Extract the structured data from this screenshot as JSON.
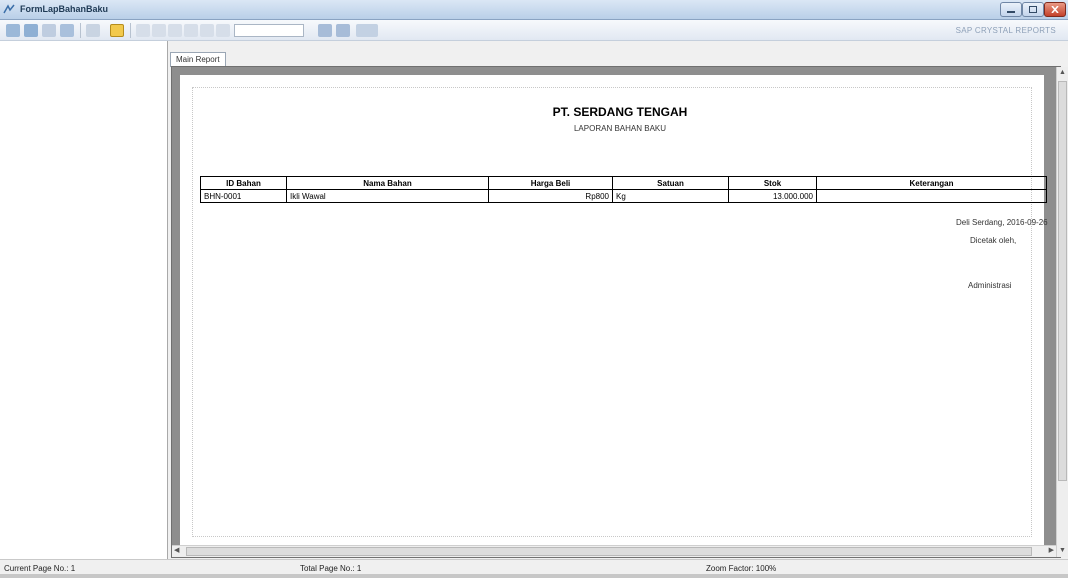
{
  "window": {
    "title": "FormLapBahanBaku"
  },
  "toolbar": {
    "search_value": "",
    "brand_text": "SAP CRYSTAL REPORTS"
  },
  "tabs": [
    {
      "label": "Main Report"
    }
  ],
  "report": {
    "company": "PT. SERDANG TENGAH",
    "title": "LAPORAN BAHAN BAKU",
    "columns": [
      "ID Bahan",
      "Nama Bahan",
      "Harga Beli",
      "Satuan",
      "Stok",
      "Keterangan"
    ],
    "rows": [
      {
        "id": "BHN-0001",
        "nama": "Ikli Wawal",
        "harga": "Rp800",
        "satuan": "Kg",
        "stok": "13.000.000",
        "keterangan": ""
      }
    ],
    "place_date": "Deli Serdang, 2016-09-26",
    "printed_by": "Dicetak oleh,",
    "signer": "Administrasi"
  },
  "status": {
    "current_page": "Current Page No.: 1",
    "total_page": "Total Page No.: 1",
    "zoom": "Zoom Factor: 100%"
  },
  "colors": {
    "titlebar": "#b9cfe8",
    "frame": "#8e8e8e",
    "close": "#c4412a"
  }
}
